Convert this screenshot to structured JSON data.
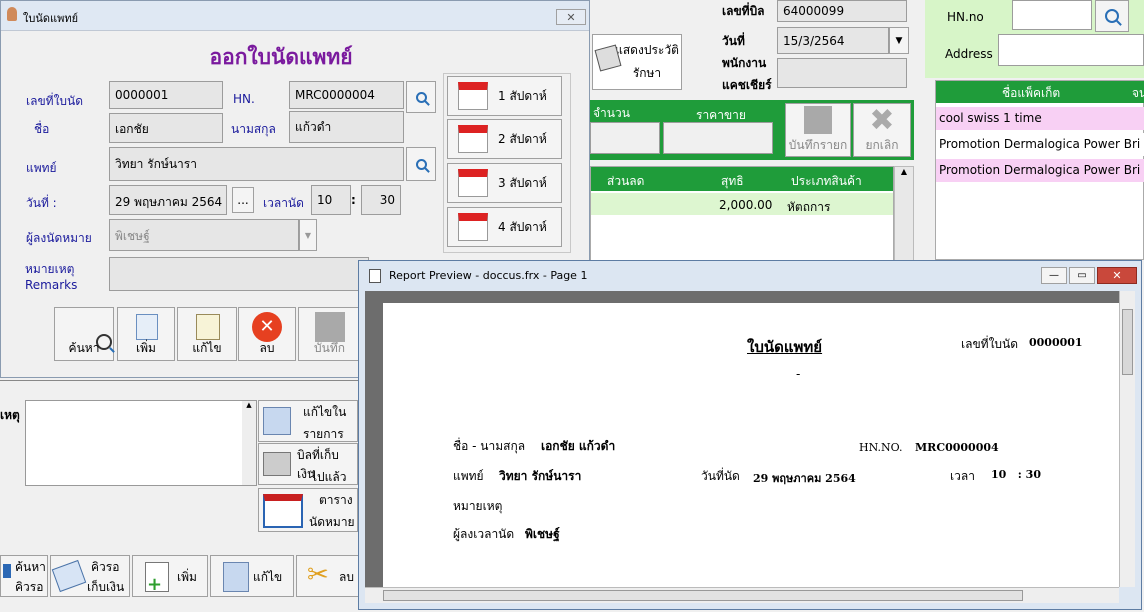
{
  "appt_window": {
    "title": "ใบนัดแพทย์",
    "heading": "ออกใบนัดแพทย์",
    "appt_no_label": "เลขที่ใบนัด",
    "appt_no": "0000001",
    "hn_label": "HN.",
    "hn": "MRC0000004",
    "name_label": "ชื่อ",
    "name": "เอกชัย",
    "surname_label": "นามสกุล",
    "surname": "แก้วดำ",
    "doctor_label": "แพทย์",
    "doctor": "วิทยา  รักษ์นารา",
    "date_label": "วันที่ :",
    "date": "29 พฤษภาคม 2564",
    "date_button": "...",
    "time_label": "เวลานัด",
    "hour": "10",
    "time_sep": ":",
    "minute": "30",
    "recorder_label": "ผู้ลงนัดหมาย",
    "recorder": "พิเชษฐ์",
    "remarks_label_th": "หมายเหตุ",
    "remarks_label_en": "Remarks",
    "weeks": [
      "1  สัปดาห์",
      "2  สัปดาห์",
      "3  สัปดาห์",
      "4  สัปดาห์"
    ],
    "toolbar": {
      "search": "ค้นหา",
      "add": "เพิ่ม",
      "edit": "แก้ไข",
      "delete": "ลบ",
      "save": "บันทึก"
    }
  },
  "main_window": {
    "bill_no_label": "เลขที่บิล",
    "bill_no": "64000099",
    "date_label": "วันที่",
    "date": "15/3/2564",
    "staff_label": "พนักงาน",
    "cashier_label": "แคชเชียร์",
    "show_history_button": [
      "แสดงประวัติ",
      "รักษา"
    ],
    "qty_label": "จำนวน",
    "price_label": "ราคาขาย",
    "save_item_button": "บันทึกรายก",
    "cancel_button": "ยกเลิก",
    "columns": [
      "ส่วนลด",
      "สุทธิ",
      "ประเภทสินค้า"
    ],
    "row": {
      "net": "2,000.00",
      "type": "หัตถการ"
    },
    "remarks_label": "เหตุ",
    "side_buttons": [
      {
        "line1": "แก้ไขใน",
        "line2": "รายการ"
      },
      {
        "line1": "บิลที่เก็บเงิน",
        "line2": "ไปแล้ว"
      },
      {
        "line1": "ตาราง",
        "line2": "นัดหมาย"
      }
    ],
    "bottom_buttons": [
      {
        "line1": "ค้นหา",
        "line2": "คิวรอ"
      },
      {
        "line1": "คิวรอ",
        "line2": "เก็บเงิน"
      },
      {
        "line1": "เพิ่ม",
        "line2": ""
      },
      {
        "line1": "แก้ไข",
        "line2": ""
      },
      {
        "line1": "ลบ",
        "line2": ""
      }
    ],
    "hn_label": "HN.no",
    "address_label": "Address",
    "package_header": "ชื่อแพ็คเก็ต",
    "package_header2": "จน",
    "packages": [
      "cool swiss 1 time",
      "Promotion Dermalogica Power Bri",
      "Promotion Dermalogica Power Bri"
    ]
  },
  "report_window": {
    "title": "Report Preview - doccus.frx - Page 1",
    "doc_title": "ใบนัดแพทย์",
    "appt_no_label": "เลขที่ใบนัด",
    "appt_no": "0000001",
    "dash": "-",
    "name_label": "ชื่อ - นามสกุล",
    "name": "เอกชัย  แก้วดำ",
    "hn_label": "HN.NO.",
    "hn": "MRC0000004",
    "doctor_label": "แพทย์",
    "doctor": "วิทยา  รักษ์นารา",
    "date_label": "วันที่นัด",
    "date": "29 พฤษภาคม 2564",
    "time_label": "เวลา",
    "time": "10   : 30",
    "remarks_label": "หมายเหตุ",
    "recorder_label": "ผู้ลงเวลานัด",
    "recorder": "พิเชษฐ์"
  }
}
